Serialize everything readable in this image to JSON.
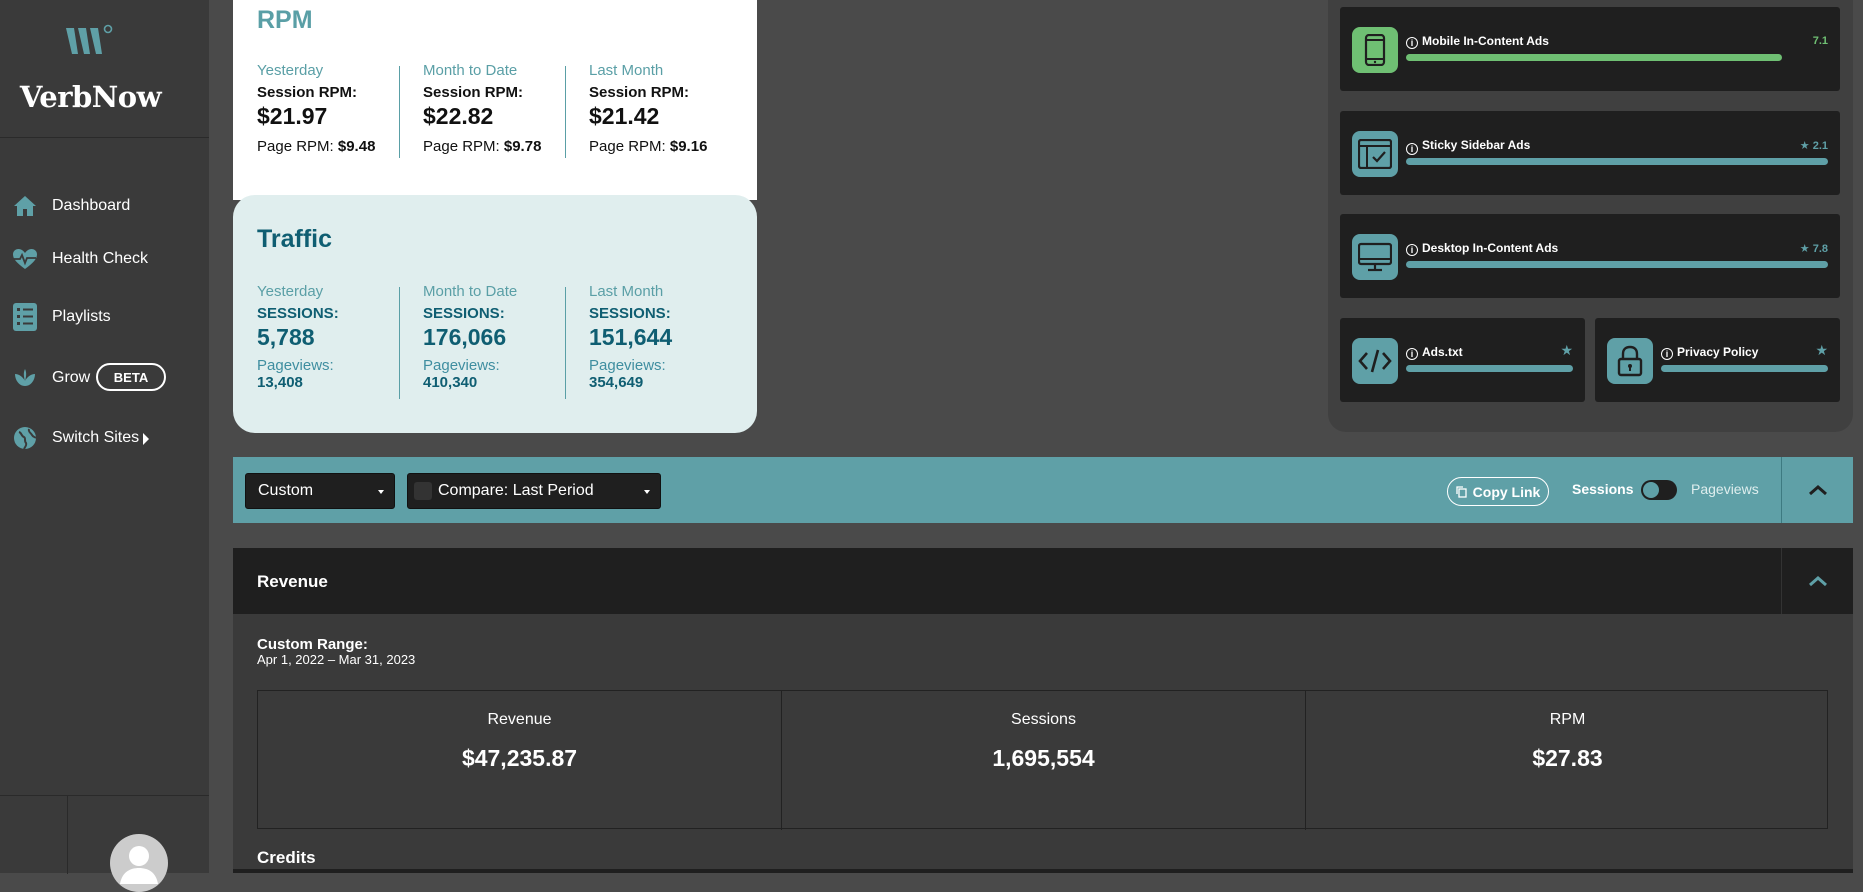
{
  "brand": {
    "name": "VerbNow",
    "accent": "#5fa0a7"
  },
  "nav": {
    "items": [
      {
        "label": "Dashboard",
        "icon": "home-icon"
      },
      {
        "label": "Health Check",
        "icon": "heart-pulse-icon"
      },
      {
        "label": "Playlists",
        "icon": "list-icon"
      },
      {
        "label": "Grow",
        "icon": "leaf-icon",
        "badge": "BETA"
      },
      {
        "label": "Switch Sites",
        "icon": "globe-icon"
      }
    ]
  },
  "rpm": {
    "title": "RPM",
    "columns": [
      {
        "period": "Yesterday",
        "label": "Session RPM:",
        "value": "$21.97",
        "page_label": "Page RPM:",
        "page_value": "$9.48"
      },
      {
        "period": "Month to Date",
        "label": "Session RPM:",
        "value": "$22.82",
        "page_label": "Page RPM:",
        "page_value": "$9.78"
      },
      {
        "period": "Last Month",
        "label": "Session RPM:",
        "value": "$21.42",
        "page_label": "Page RPM:",
        "page_value": "$9.16"
      }
    ]
  },
  "traffic": {
    "title": "Traffic",
    "columns": [
      {
        "period": "Yesterday",
        "label": "SESSIONS:",
        "value": "5,788",
        "pv_label": "Pageviews:",
        "pv_value": "13,408"
      },
      {
        "period": "Month to Date",
        "label": "SESSIONS:",
        "value": "176,066",
        "pv_label": "Pageviews:",
        "pv_value": "410,340"
      },
      {
        "period": "Last Month",
        "label": "SESSIONS:",
        "value": "151,644",
        "pv_label": "Pageviews:",
        "pv_value": "354,649"
      }
    ]
  },
  "ad_health": {
    "items": [
      {
        "name": "Mobile In-Content Ads",
        "score": "7.1",
        "progress": 0.88,
        "color": "#6fbf73",
        "icon": "mobile-icon"
      },
      {
        "name": "Sticky Sidebar Ads",
        "score": "2.1",
        "progress": 1.0,
        "color": "#5fa0a7",
        "icon": "browser-check-icon"
      },
      {
        "name": "Desktop In-Content Ads",
        "score": "7.8",
        "progress": 1.0,
        "color": "#5fa0a7",
        "icon": "desktop-icon"
      },
      {
        "name": "Ads.txt",
        "score": "",
        "progress": 1.0,
        "color": "#5fa0a7",
        "icon": "code-icon"
      },
      {
        "name": "Privacy Policy",
        "score": "",
        "progress": 1.0,
        "color": "#5fa0a7",
        "icon": "lock-icon"
      }
    ]
  },
  "toolbar": {
    "range_select": "Custom",
    "compare_select": "Compare: Last Period",
    "copy_link": "Copy Link",
    "toggle_left": "Sessions",
    "toggle_right": "Pageviews"
  },
  "revenue": {
    "title": "Revenue",
    "range_label": "Custom Range:",
    "range_value": "Apr 1, 2022 – Mar 31, 2023",
    "stats": [
      {
        "label": "Revenue",
        "value": "$47,235.87"
      },
      {
        "label": "Sessions",
        "value": "1,695,554"
      },
      {
        "label": "RPM",
        "value": "$27.83"
      }
    ],
    "credits_title": "Credits"
  }
}
